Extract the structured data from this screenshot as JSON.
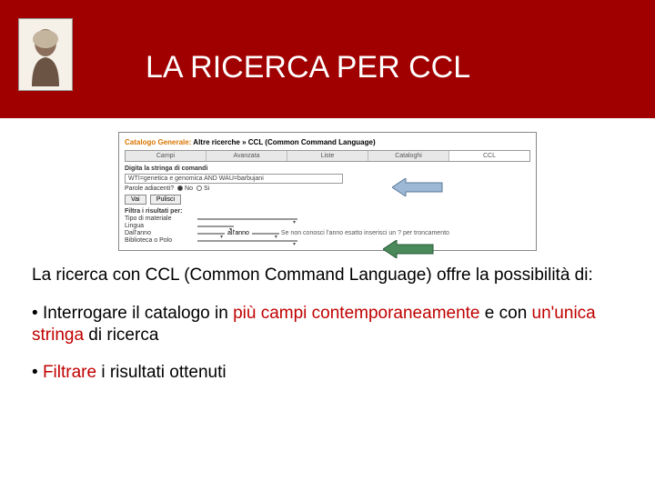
{
  "slide": {
    "title": "LA RICERCA PER CCL"
  },
  "screenshot": {
    "breadcrumb_orange": "Catalogo Generale:",
    "breadcrumb_rest": " Altre ricerche » CCL (Common Command Language)",
    "tabs": [
      "Campi",
      "Avanzata",
      "Liste",
      "Cataloghi",
      "CCL"
    ],
    "section1_label": "Digita la stringa di comandi",
    "input_value": "WTI=genetica e genomica AND WAU=barbujani",
    "adjacent_label": "Parole adiacenti?",
    "adjacent_no": "No",
    "adjacent_yes": "Si",
    "btn_go": "Vai",
    "btn_clear": "Pulisci",
    "filter_heading": "Filtra i risultati per:",
    "rows": {
      "material_label": "Tipo di materiale",
      "lang_label": "Lingua",
      "year_label": "Dall'anno",
      "year_to": "all'anno",
      "year_note": "Se non conosci l'anno esatto inserisci un ? per troncamento",
      "bib_label": "Biblioteca o Polo"
    },
    "empty_select": " "
  },
  "text": {
    "intro_a": "La ricerca con CCL (Common Command Language) offre la possibilità di:",
    "bullet1_a": "Interrogare il catalogo in ",
    "bullet1_red": "più campi contemporaneamente",
    "bullet1_b": " e con ",
    "bullet1_red2": "un'unica stringa",
    "bullet1_c": " di ricerca",
    "bullet2_red": "Filtrare",
    "bullet2_a": " i risultati ottenuti"
  }
}
